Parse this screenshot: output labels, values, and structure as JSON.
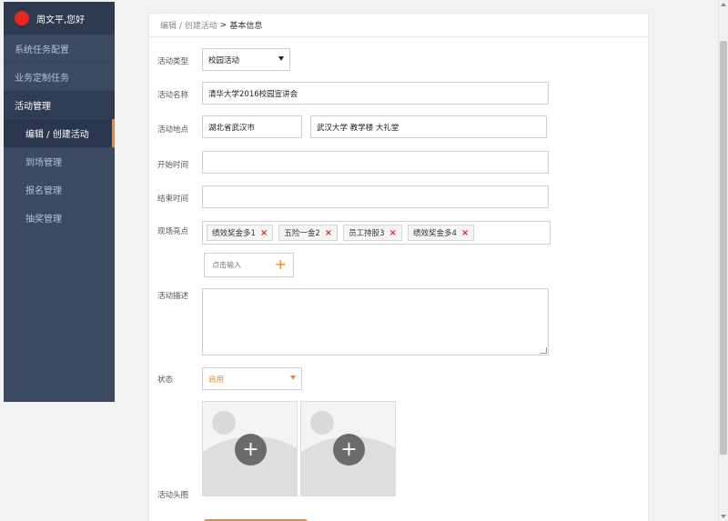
{
  "sidebar": {
    "greeting": "周文平,您好",
    "items": [
      {
        "label": "系统任务配置"
      },
      {
        "label": "业务定制任务"
      },
      {
        "label": "活动管理"
      }
    ],
    "subitems": [
      {
        "label": "编辑 / 创建活动"
      },
      {
        "label": "到场管理"
      },
      {
        "label": "报名管理"
      },
      {
        "label": "抽奖管理"
      }
    ]
  },
  "breadcrumb": {
    "path": "编辑 / 创建活动",
    "separator": ">",
    "current": "基本信息"
  },
  "form": {
    "type_label": "活动类型",
    "type_value": "校园活动",
    "name_label": "活动名称",
    "name_value": "清华大学2016校园宣讲会",
    "location_label": "活动地点",
    "location_city": "湖北省武汉市",
    "location_detail": "武汉大学 教学楼 大礼堂",
    "start_label": "开始时间",
    "start_value": "",
    "end_label": "结束时间",
    "end_value": "",
    "highlights_label": "现场亮点",
    "highlights": [
      {
        "text": "绩效奖金多1"
      },
      {
        "text": "五险一金2"
      },
      {
        "text": "员工持股3"
      },
      {
        "text": "绩效奖金多4"
      }
    ],
    "remove_glyph": "×",
    "add_placeholder": "点击输入",
    "add_glyph": "+",
    "desc_label": "活动描述",
    "desc_value": "",
    "status_label": "状态",
    "status_value": "启用",
    "avatar_label": "活动头图",
    "upload_glyph": "+"
  },
  "colors": {
    "sidebar_bg": "#3b4961",
    "accent": "#f08a24",
    "danger": "#e8281e"
  }
}
